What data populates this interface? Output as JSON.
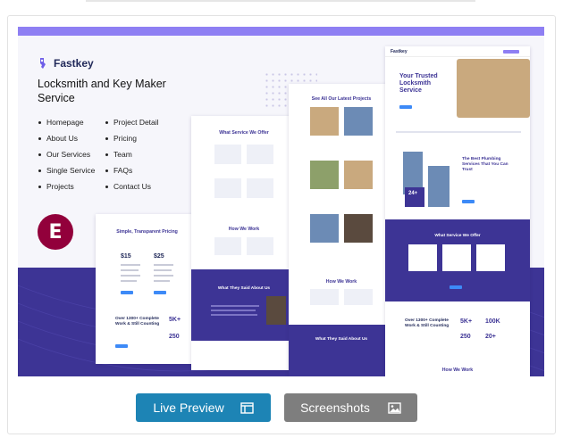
{
  "product": {
    "logo_text": "Fastkey",
    "title": "Locksmith and Key Maker Service",
    "builder_logo_glyph": "E"
  },
  "nav": {
    "col1": [
      "Homepage",
      "About Us",
      "Our Services",
      "Single Service",
      "Projects"
    ],
    "col2": [
      "Project Detail",
      "Pricing",
      "Team",
      "FAQs",
      "Contact Us"
    ]
  },
  "screens": {
    "services_heading": "What Service We Offer",
    "pricing_heading": "Simple, Transparent Pricing",
    "projects_heading": "See All Our Latest Projects",
    "hero_heading": "Your Trusted Locksmith Service",
    "plumbing_heading": "The Best Plumbing Services That You Can Trust",
    "how_we_work": "How We Work",
    "testimonials_heading": "What They Said About Us",
    "stats_heading": "Over 1300+ Complete Work & Still Counting",
    "stat_a": "5K+",
    "stat_b": "250",
    "stat_c": "100K",
    "stat_d": "20+",
    "badge_years": "24+",
    "price_1": "$15",
    "price_2": "$25"
  },
  "actions": {
    "live_preview": "Live Preview",
    "screenshots": "Screenshots"
  },
  "colors": {
    "brand": "#3d3495",
    "accent": "#8e7ff3",
    "live_button": "#1d84b5",
    "screenshots_button": "#7e7e7e"
  },
  "icons": {
    "live_preview": "layout-icon",
    "screenshots": "image-icon"
  }
}
